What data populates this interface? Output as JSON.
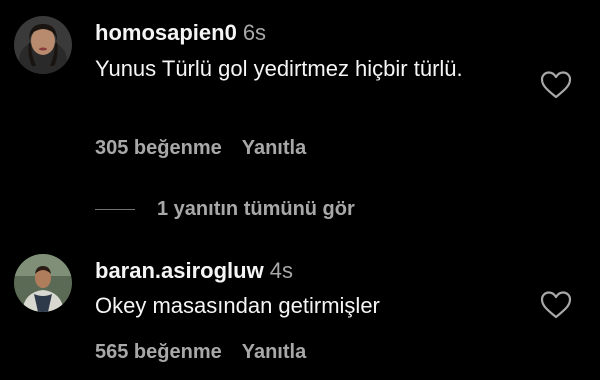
{
  "comments": [
    {
      "username": "homosapien0",
      "time": "6s",
      "text": "Yunus Türlü gol yedirtmez hiçbir türlü.",
      "likes": "305 beğenme",
      "reply_label": "Yanıtla",
      "avatar_icon": "avatar-woman-icon"
    },
    {
      "username": "baran.asirogluw",
      "time": "4s",
      "text": "Okey masasından getirmişler",
      "likes": "565 beğenme",
      "reply_label": "Yanıtla",
      "avatar_icon": "avatar-man-icon"
    }
  ],
  "view_replies_label": "1 yanıtın tümünü gör",
  "colors": {
    "background": "#000000",
    "primary_text": "#f5f5f5",
    "secondary_text": "#a8a8a8",
    "divider": "#737373"
  }
}
